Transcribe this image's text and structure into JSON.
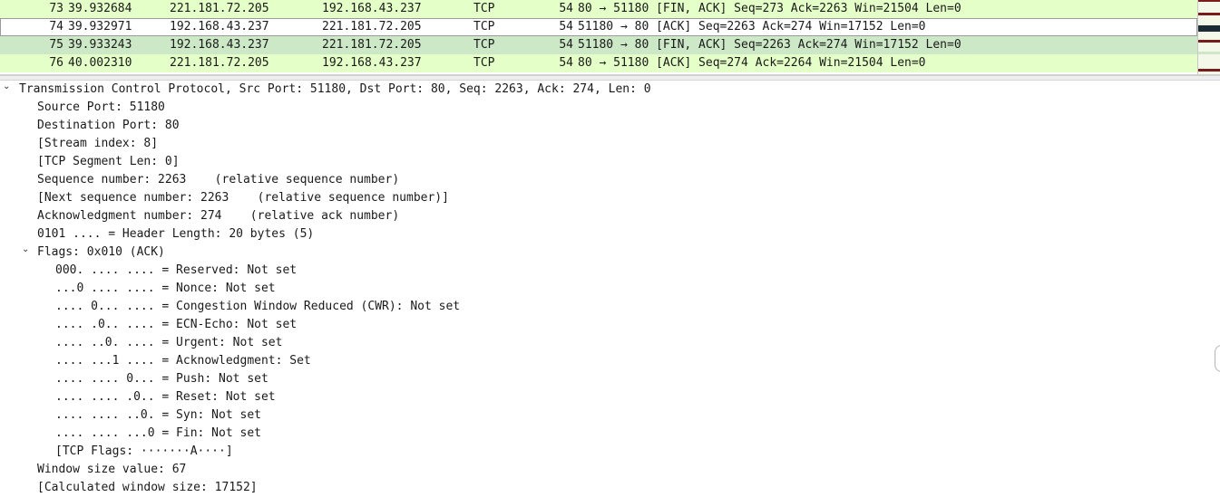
{
  "colors": {
    "tcp_row_bg": "#e4ffc7",
    "selected_row_bg": "#cde8c6",
    "mm_green": "#e4ffc7",
    "mm_darkred": "#7a1b1b",
    "mm_black": "#1a2b33"
  },
  "packets": [
    {
      "no": "73",
      "time": "39.932684",
      "src": "221.181.72.205",
      "dst": "192.168.43.237",
      "proto": "TCP",
      "len": "54",
      "info": "80 → 51180 [FIN, ACK] Seq=273 Ack=2263 Win=21504 Len=0"
    },
    {
      "no": "74",
      "time": "39.932971",
      "src": "192.168.43.237",
      "dst": "221.181.72.205",
      "proto": "TCP",
      "len": "54",
      "info": "51180 → 80 [ACK] Seq=2263 Ack=274 Win=17152 Len=0"
    },
    {
      "no": "75",
      "time": "39.933243",
      "src": "192.168.43.237",
      "dst": "221.181.72.205",
      "proto": "TCP",
      "len": "54",
      "info": "51180 → 80 [FIN, ACK] Seq=2263 Ack=274 Win=17152 Len=0"
    },
    {
      "no": "76",
      "time": "40.002310",
      "src": "221.181.72.205",
      "dst": "192.168.43.237",
      "proto": "TCP",
      "len": "54",
      "info": "80 → 51180 [ACK] Seq=274 Ack=2264 Win=21504 Len=0"
    }
  ],
  "details": {
    "root": "Transmission Control Protocol, Src Port: 51180, Dst Port: 80, Seq: 2263, Ack: 274, Len: 0",
    "source_port": "Source Port: 51180",
    "destination_port": "Destination Port: 80",
    "stream_index": "[Stream index: 8]",
    "segment_len": "[TCP Segment Len: 0]",
    "sequence_number": "Sequence number: 2263    (relative sequence number)",
    "next_sequence": "[Next sequence number: 2263    (relative sequence number)]",
    "ack_number": "Acknowledgment number: 274    (relative ack number)",
    "header_length": "0101 .... = Header Length: 20 bytes (5)",
    "flags": "Flags: 0x010 (ACK)",
    "flag_items": [
      "000. .... .... = Reserved: Not set",
      "...0 .... .... = Nonce: Not set",
      ".... 0... .... = Congestion Window Reduced (CWR): Not set",
      ".... .0.. .... = ECN-Echo: Not set",
      ".... ..0. .... = Urgent: Not set",
      ".... ...1 .... = Acknowledgment: Set",
      ".... .... 0... = Push: Not set",
      ".... .... .0.. = Reset: Not set",
      ".... .... ..0. = Syn: Not set",
      ".... .... ...0 = Fin: Not set",
      "[TCP Flags: ·······A····]"
    ],
    "window_size": "Window size value: 67",
    "calc_window": "[Calculated window size: 17152]"
  },
  "icons": {
    "expanded_chevron": "⌄"
  }
}
